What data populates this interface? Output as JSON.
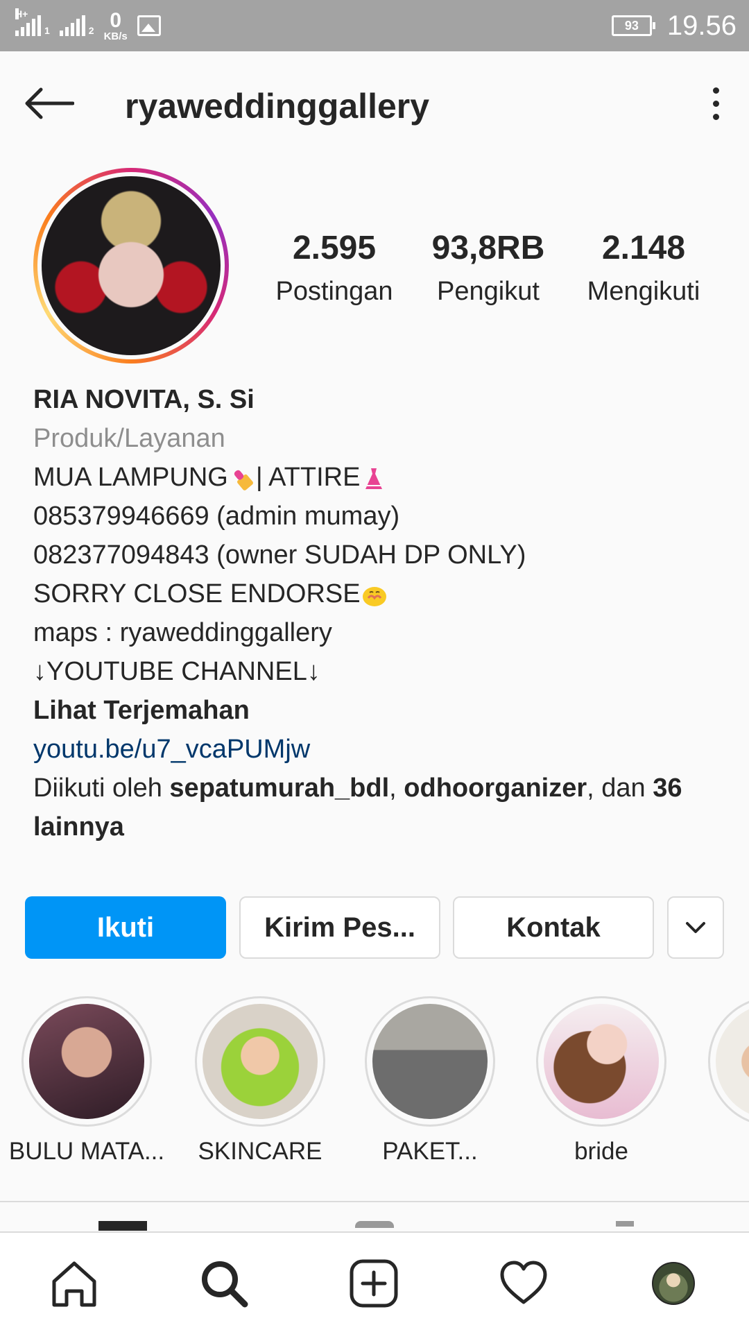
{
  "status_bar": {
    "network_label": "H+",
    "sim1_sub": "1",
    "sim2_sub": "2",
    "speed_value": "0",
    "speed_unit": "KB/s",
    "battery": "93",
    "time": "19.56"
  },
  "header": {
    "username": "ryaweddinggallery"
  },
  "stats": {
    "posts": {
      "value": "2.595",
      "label": "Postingan"
    },
    "followers": {
      "value": "93,8RB",
      "label": "Pengikut"
    },
    "following": {
      "value": "2.148",
      "label": "Mengikuti"
    }
  },
  "bio": {
    "name": "RIA NOVITA, S. Si",
    "category": "Produk/Layanan",
    "line1_a": "MUA LAMPUNG",
    "line1_b": "| ATTIRE",
    "line2": "085379946669 (admin mumay)",
    "line3": "082377094843 (owner SUDAH DP ONLY)",
    "line4": "SORRY CLOSE ENDORSE",
    "line5": "maps : ryaweddinggallery",
    "line6": "↓YOUTUBE CHANNEL↓",
    "translate": "Lihat Terjemahan",
    "link": "youtu.be/u7_vcaPUMjw",
    "followed_prefix": "Diikuti oleh ",
    "followed_user1": "sepatumurah_bdl",
    "followed_sep": ", ",
    "followed_user2": "odhoorganizer",
    "followed_mid": ", dan ",
    "followed_others": "36 lainnya"
  },
  "actions": {
    "follow": "Ikuti",
    "message": "Kirim Pes...",
    "contact": "Kontak"
  },
  "highlights": [
    {
      "label": "BULU MATA..."
    },
    {
      "label": "SKINCARE"
    },
    {
      "label": "PAKET..."
    },
    {
      "label": "bride"
    }
  ],
  "colors": {
    "primary": "#0095f6",
    "link": "#00376b",
    "secondary_text": "#8e8e8e",
    "status_bar": "#a3a3a3"
  },
  "icons": {
    "header": [
      "back-arrow-icon",
      "more-options-icon"
    ],
    "bottom_nav": [
      "home-icon",
      "search-icon",
      "add-post-icon",
      "heart-icon",
      "profile-avatar"
    ]
  }
}
